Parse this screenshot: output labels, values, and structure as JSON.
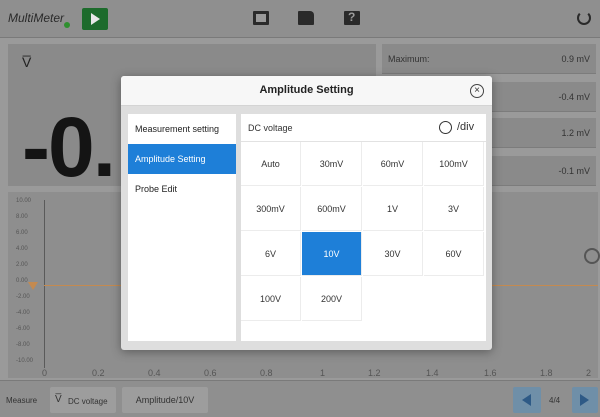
{
  "app": {
    "title": "MultiMeter"
  },
  "reading": {
    "symbol": "V̅",
    "value": "-0."
  },
  "stats": [
    {
      "label": "Maximum:",
      "value": "0.9 mV"
    },
    {
      "label": "",
      "value": "-0.4 mV"
    },
    {
      "label": "",
      "value": "1.2 mV"
    },
    {
      "label": "",
      "value": "-0.1 mV"
    }
  ],
  "waveform": {
    "y_ticks": [
      "10.00",
      "8.00",
      "6.00",
      "4.00",
      "2.00",
      "0.00",
      "-2.00",
      "-4.00",
      "-6.00",
      "-8.00",
      "-10.00"
    ],
    "x_ticks": [
      "0",
      "0.2",
      "0.4",
      "0.6",
      "0.8",
      "1",
      "1.2",
      "1.4",
      "1.6",
      "1.8",
      "2"
    ]
  },
  "bottombar": {
    "measure_label": "Measure",
    "dc_label": "DC voltage",
    "amplitude_label": "Amplitude/10V",
    "page": "4/4"
  },
  "modal": {
    "title": "Amplitude Setting",
    "menu": [
      "Measurement setting",
      "Amplitude Setting",
      "Probe Edit"
    ],
    "active_menu": 1,
    "panel_title": "DC voltage",
    "div_label": "/div",
    "options": [
      "Auto",
      "30mV",
      "60mV",
      "100mV",
      "300mV",
      "600mV",
      "1V",
      "3V",
      "6V",
      "10V",
      "30V",
      "60V",
      "100V",
      "200V"
    ],
    "selected_option": 9
  },
  "colors": {
    "accent": "#1e7fd8",
    "play": "#1d6b2c",
    "trace": "#c48a50"
  }
}
